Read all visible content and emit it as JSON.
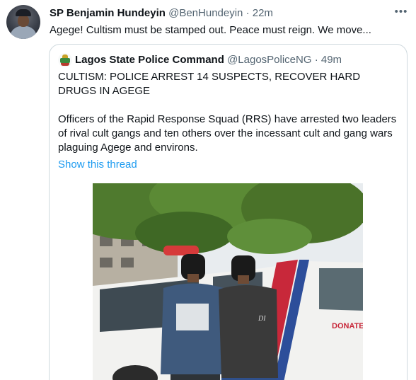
{
  "tweet": {
    "author_name": "SP Benjamin Hundeyin",
    "author_handle": "@BenHundeyin",
    "separator": "·",
    "time": "22m",
    "text": "Agege! Cultism must be stamped out. Peace must reign. We move...",
    "more_icon": "more-horizontal-icon"
  },
  "quote": {
    "author_name": "Lagos State Police Command",
    "author_handle": "@LagosPoliceNG",
    "separator": "·",
    "time": "49m",
    "headline": "CULTISM: POLICE ARREST 14 SUSPECTS, RECOVER HARD DRUGS IN AGEGE",
    "body": "Officers of the Rapid Response Squad (RRS) have arrested two leaders of rival cult gangs and ten others over the incessant cult and gang wars plaguing Agege and environs.",
    "link_label": "Show this thread"
  },
  "photo": {
    "vehicle_text": "DONATE",
    "shirt_text": "DI",
    "colors": {
      "foliage": "#4f7a2e",
      "sky": "#e8ecef",
      "vehicle": "#f2f2f0",
      "stripe_red": "#c8283a",
      "stripe_blue": "#2d4e9a"
    }
  },
  "colors": {
    "text": "#0f1419",
    "muted": "#536471",
    "link": "#1d9bf0",
    "border": "#cfd9de"
  }
}
